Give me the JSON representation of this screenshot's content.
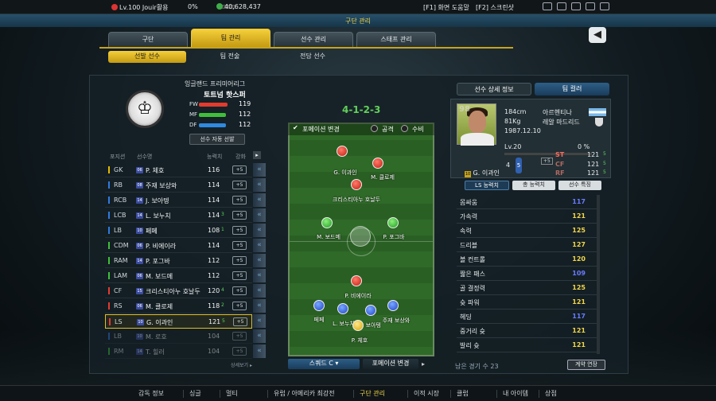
{
  "topbar": {
    "level": "Lv.100 Jouir활용",
    "exp": "0%",
    "money": "40,628,437",
    "help": "[F1] 화면 도움말",
    "screenshot": "[F2] 스크린샷"
  },
  "header": {
    "title": "구단 관리"
  },
  "tabs": [
    "구단",
    "팀 관리",
    "선수 관리",
    "스태프 관리"
  ],
  "subtabs": [
    "선발 선수",
    "팀 전술",
    "전담 선수"
  ],
  "team": {
    "league": "잉글랜드 프리미어리그",
    "name": "토트넘 핫스퍼",
    "stats": [
      {
        "label": "FW",
        "value": "119",
        "color": "#e33b2f"
      },
      {
        "label": "MF",
        "value": "112",
        "color": "#3fbf3a"
      },
      {
        "label": "DF",
        "value": "112",
        "color": "#2f8ae0"
      }
    ],
    "auto_button": "선수 자동 선발"
  },
  "roster": {
    "headers": [
      "포지션",
      "선수명",
      "능력치",
      "강화"
    ],
    "rows": [
      {
        "pos": "GK",
        "num": "06",
        "name": "P. 체호",
        "ovr": "116",
        "arr": "",
        "plus": "+5",
        "color": "#e6b800"
      },
      {
        "pos": "RB",
        "num": "08",
        "name": "주재 보상와",
        "ovr": "114",
        "arr": "",
        "plus": "+5",
        "color": "#2f7ae0"
      },
      {
        "pos": "RCB",
        "num": "14",
        "name": "J. 보아텡",
        "ovr": "114",
        "arr": "",
        "plus": "+5",
        "color": "#2f7ae0"
      },
      {
        "pos": "LCB",
        "num": "14",
        "name": "L. 보누치",
        "ovr": "114",
        "arr": "3",
        "plus": "+5",
        "color": "#2f7ae0"
      },
      {
        "pos": "LB",
        "num": "10",
        "name": "페페",
        "ovr": "108",
        "arr": "1",
        "plus": "+5",
        "color": "#2f7ae0"
      },
      {
        "pos": "CDM",
        "num": "06",
        "name": "P. 비에이라",
        "ovr": "114",
        "arr": "",
        "plus": "+5",
        "color": "#3fbf3a"
      },
      {
        "pos": "RAM",
        "num": "14",
        "name": "P. 포그바",
        "ovr": "112",
        "arr": "",
        "plus": "+5",
        "color": "#3fbf3a"
      },
      {
        "pos": "LAM",
        "num": "06",
        "name": "M. 보드메",
        "ovr": "112",
        "arr": "",
        "plus": "+5",
        "color": "#3fbf3a"
      },
      {
        "pos": "CF",
        "num": "15",
        "name": "크리스티아누 호날두",
        "ovr": "120",
        "arr": "4",
        "plus": "+5",
        "color": "#e33b2f"
      },
      {
        "pos": "RS",
        "num": "06",
        "name": "M. 클로제",
        "ovr": "118",
        "arr": "2",
        "plus": "+5",
        "color": "#e33b2f"
      },
      {
        "pos": "LS",
        "num": "10",
        "name": "G. 이과인",
        "ovr": "121",
        "arr": "5",
        "plus": "+5",
        "color": "#e33b2f"
      },
      {
        "pos": "LB",
        "num": "10",
        "name": "M. 로호",
        "ovr": "104",
        "arr": "",
        "plus": "+5",
        "color": "#2f7ae0"
      },
      {
        "pos": "RM",
        "num": "14",
        "name": "T. 힐러",
        "ovr": "104",
        "arr": "",
        "plus": "+5",
        "color": "#3fbf3a"
      }
    ],
    "detail": "상세보기"
  },
  "formation": {
    "name": "4-1-2-3",
    "change": "포메이션 변경",
    "attack": "공격",
    "defense": "수비",
    "players": [
      {
        "label": "G. 이과인",
        "kind": "r"
      },
      {
        "label": "M. 클로제",
        "kind": "r"
      },
      {
        "label": "크리스티아누 호날두",
        "kind": "r"
      },
      {
        "label": "M. 보드메",
        "kind": "g"
      },
      {
        "label": "P. 포그바",
        "kind": "g"
      },
      {
        "label": "P. 비에이라",
        "kind": "r"
      },
      {
        "label": "페페",
        "kind": "b"
      },
      {
        "label": "L. 보누치",
        "kind": "b"
      },
      {
        "label": "J. 보아텡",
        "kind": "b"
      },
      {
        "label": "주재 보상와",
        "kind": "b"
      },
      {
        "label": "P. 체호",
        "kind": "y"
      }
    ],
    "squad": "스쿼드 C",
    "formation_change": "포메이션 변경"
  },
  "detail_panel": {
    "tab1": "선수 상세 정보",
    "tab2": "팀 컬러",
    "height": "184cm",
    "weight": "81Kg",
    "birth": "1987.12.10",
    "nation": "아르헨티나",
    "club": "레알 마드리드",
    "level": "Lv.20",
    "exp": "0 %",
    "name": "G. 이과인",
    "num": "10",
    "plus": "+5",
    "foot_l": "4",
    "foot_r": "5",
    "pos_ratings": [
      {
        "pos": "ST",
        "value": "121",
        "arr": "5"
      },
      {
        "pos": "CF",
        "value": "121",
        "arr": "5"
      },
      {
        "pos": "RF",
        "value": "121",
        "arr": "5"
      }
    ],
    "btn1": "LS 능력치",
    "btn2": "총 능력치",
    "btn3": "선수 특징",
    "stats": [
      {
        "name": "몸싸움",
        "value": "117",
        "color": "#6a7bff"
      },
      {
        "name": "가속력",
        "value": "121",
        "color": "#f2d64a"
      },
      {
        "name": "속력",
        "value": "125",
        "color": "#f2d64a"
      },
      {
        "name": "드리블",
        "value": "127",
        "color": "#f2d64a"
      },
      {
        "name": "볼 컨트롤",
        "value": "120",
        "color": "#f2d64a"
      },
      {
        "name": "짧은 패스",
        "value": "109",
        "color": "#6a7bff"
      },
      {
        "name": "골 결정력",
        "value": "125",
        "color": "#f2d64a"
      },
      {
        "name": "슛 파워",
        "value": "121",
        "color": "#f2d64a"
      },
      {
        "name": "헤딩",
        "value": "117",
        "color": "#6a7bff"
      },
      {
        "name": "중거리 슛",
        "value": "121",
        "color": "#f2d64a"
      },
      {
        "name": "발리 슛",
        "value": "121",
        "color": "#f2d64a"
      }
    ],
    "matches": "남은 경기 수 23",
    "contract": "계약 연장"
  },
  "bottom": [
    "감독 정보",
    "싱글",
    "멀티",
    "유럽 / 아메리카 최강전",
    "구단 관리",
    "이적 시장",
    "클럽",
    "내 아이템",
    "상점"
  ]
}
